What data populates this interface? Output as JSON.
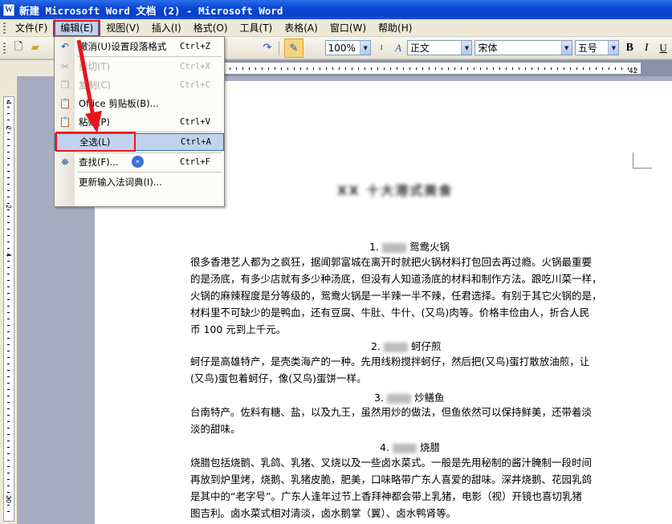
{
  "window": {
    "title": "新建 Microsoft Word 文档 (2) - Microsoft Word",
    "app_icon": "W"
  },
  "menubar": {
    "items": [
      "文件(F)",
      "编辑(E)",
      "视图(V)",
      "插入(I)",
      "格式(O)",
      "工具(T)",
      "表格(A)",
      "窗口(W)",
      "帮助(H)"
    ],
    "active_index": 1
  },
  "toolbar": {
    "zoom": "100%",
    "style": "正文",
    "font": "宋体",
    "size": "五号",
    "bold": "B",
    "italic": "I",
    "style_icon_label": "A"
  },
  "edit_menu": {
    "items": [
      {
        "label": "撤消(U)设置段落格式",
        "shortcut": "Ctrl+Z",
        "icon": "undo-icon",
        "glyph": "↶",
        "enabled": true
      },
      {
        "label": "剪切(T)",
        "shortcut": "Ctrl+X",
        "icon": "cut-icon",
        "glyph": "✂",
        "enabled": false
      },
      {
        "label": "复制(C)",
        "shortcut": "Ctrl+C",
        "icon": "copy-icon",
        "glyph": "❐",
        "enabled": false
      },
      {
        "label": "Office 剪贴板(B)...",
        "shortcut": "",
        "icon": "clipboard-icon",
        "glyph": "📋",
        "enabled": true
      },
      {
        "label": "粘贴(P)",
        "shortcut": "Ctrl+V",
        "icon": "paste-icon",
        "glyph": "📋",
        "enabled": true
      },
      {
        "label": "全选(L)",
        "shortcut": "Ctrl+A",
        "icon": "",
        "glyph": "",
        "enabled": true,
        "selected": true
      },
      {
        "label": "查找(F)...",
        "shortcut": "Ctrl+F",
        "icon": "binoculars-icon",
        "glyph": "⛯",
        "enabled": true
      },
      {
        "label": "更新输入法词典(I)...",
        "shortcut": "",
        "icon": "",
        "glyph": "",
        "enabled": true
      }
    ],
    "expand_glyph": "»"
  },
  "ruler": {
    "h_numbers": [
      "2",
      "4",
      "42"
    ],
    "v_numbers": [
      "4",
      "2",
      "2",
      "4",
      "20"
    ]
  },
  "document": {
    "title": "XX 十大港式美食",
    "sections": [
      {
        "heading_prefix": "1.",
        "heading": "鸳鸯火锅",
        "lines": [
          "很多香港艺人都为之疯狂，据闻郭富城在离开时就把火锅材料打包回去再过瘾。火锅最重要",
          "的是汤底，有多少店就有多少种汤底，但没有人知道汤底的材料和制作方法。跟吃川菜一样，",
          "火锅的麻辣程度是分等级的，鸳鸯火锅是一半辣一半不辣，任君选择。有别于其它火锅的是，",
          "材料里不可缺少的是鸭血，还有豆腐、牛肚、牛什、(又鸟)肉等。价格丰俭由人，折合人民",
          "币 100 元到上千元。"
        ]
      },
      {
        "heading_prefix": "2.",
        "heading": "蚵仔煎",
        "lines": [
          "蚵仔是高雄特产，是壳类海产的一种。先用线粉搅拌蚵仔，然后把(又鸟)蛋打散放油煎，让",
          "(又鸟)蛋包着蚵仔，像(又鸟)蛋饼一样。"
        ]
      },
      {
        "heading_prefix": "3.",
        "heading": "炒鳝鱼",
        "lines": [
          "台南特产。佐料有糖、盐，以及九王，虽然用炒的做法，但鱼依然可以保持鲜美，还带着淡",
          "淡的甜味。"
        ]
      },
      {
        "heading_prefix": "4.",
        "heading": "烧腊",
        "lines": [
          "烧腊包括烧鹅、乳鸽、乳猪、叉烧以及一些卤水菜式。一般是先用秘制的酱汁腌制一段时间",
          "再放到炉里烤，烧鹅、乳猪皮脆，肥美，口味略带广东人喜爱的甜味。深井烧鹅、花园乳鸽",
          "是其中的“老字号”。广东人逢年过节上香拜神都会带上乳猪，电影（视）开镜也喜切乳猪",
          "图吉利。卤水菜式相对清淡，卤水鹅掌（翼）、卤水鸭肾等。"
        ]
      }
    ]
  },
  "colors": {
    "title_bar": "#0a48d6",
    "highlight_red": "#e8141b",
    "menu_select": "#c1d2ee"
  }
}
